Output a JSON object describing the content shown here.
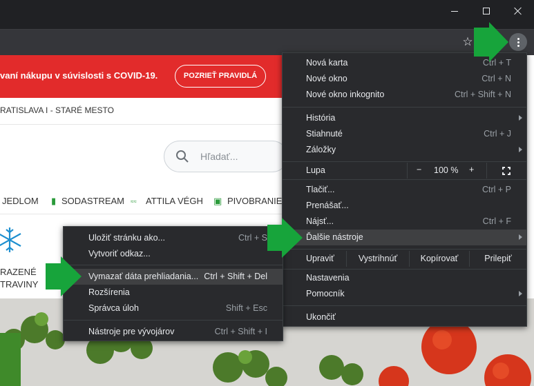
{
  "colors": {
    "titlebar": "#202124",
    "toolbar": "#35363a",
    "menu_bg": "#292a2d",
    "menu_highlight": "#3f4042",
    "banner_red": "#e22b2b",
    "arrow_green": "#17a43b"
  },
  "window_controls": {
    "minimize_icon": "minimize-icon",
    "maximize_icon": "maximize-icon",
    "close_icon": "close-icon"
  },
  "toolbar": {
    "bookmark_icon": "star-icon",
    "menu_icon": "vertical-dots-icon"
  },
  "page": {
    "banner_text": "vaní nákupu v súvislosti s COVID-19.",
    "banner_button": "POZRIEŤ PRAVIDLÁ",
    "location": "RATISLAVA I - STARÉ MESTO",
    "search_placeholder": "Hľadať...",
    "categories": [
      "JEDLOM",
      "SODASTREAM",
      "ATTILA VÉGH",
      "PIVOBRANIE"
    ],
    "frozen_line1": "RAZENÉ",
    "frozen_line2": "TRAVINY"
  },
  "menu": {
    "new_tab": {
      "label": "Nová karta",
      "shortcut": "Ctrl + T"
    },
    "new_window": {
      "label": "Nové okno",
      "shortcut": "Ctrl + N"
    },
    "incognito": {
      "label": "Nové okno inkognito",
      "shortcut": "Ctrl + Shift + N"
    },
    "history": {
      "label": "História"
    },
    "downloads": {
      "label": "Stiahnuté",
      "shortcut": "Ctrl + J"
    },
    "bookmarks": {
      "label": "Záložky"
    },
    "zoom": {
      "label": "Lupa",
      "minus": "−",
      "value": "100 %",
      "plus": "+"
    },
    "print": {
      "label": "Tlačiť...",
      "shortcut": "Ctrl + P"
    },
    "cast": {
      "label": "Prenášať..."
    },
    "find": {
      "label": "Nájsť...",
      "shortcut": "Ctrl + F"
    },
    "more_tools": {
      "label": "Ďalšie nástroje"
    },
    "edit": {
      "label": "Upraviť",
      "cut": "Vystrihnúť",
      "copy": "Kopírovať",
      "paste": "Prilepiť"
    },
    "settings": {
      "label": "Nastavenia"
    },
    "help": {
      "label": "Pomocník"
    },
    "exit": {
      "label": "Ukončiť"
    }
  },
  "submenu": {
    "save_page": {
      "label": "Uložiť stránku ako...",
      "shortcut": "Ctrl + S"
    },
    "create_shortcut": {
      "label": "Vytvoriť odkaz..."
    },
    "clear_data": {
      "label": "Vymazať dáta prehliadania...",
      "shortcut": "Ctrl + Shift + Del"
    },
    "extensions": {
      "label": "Rozšírenia"
    },
    "task_manager": {
      "label": "Správca úloh",
      "shortcut": "Shift + Esc"
    },
    "devtools": {
      "label": "Nástroje pre vývojárov",
      "shortcut": "Ctrl + Shift + I"
    }
  }
}
